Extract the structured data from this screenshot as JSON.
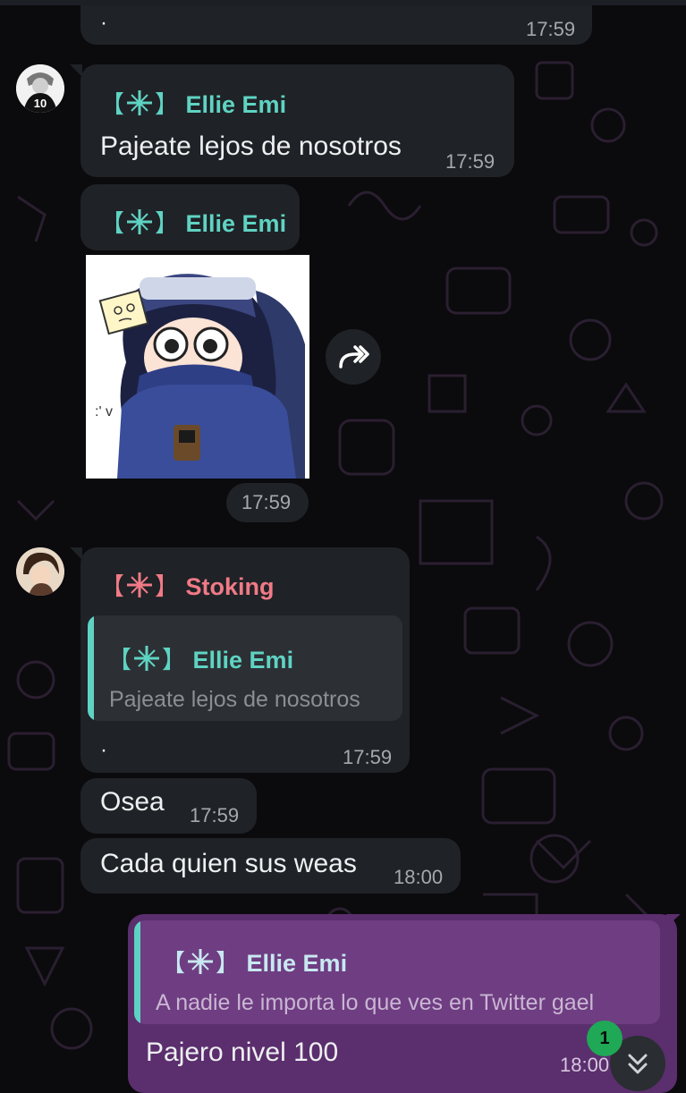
{
  "messages": [
    {
      "id": "m1",
      "text": "·",
      "time": "17:59"
    },
    {
      "id": "m2",
      "sender": "Ellie Emi",
      "bracket_left": "【",
      "bracket_right": "】",
      "text": "Pajeate lejos de nosotros",
      "time": "17:59"
    },
    {
      "id": "m3",
      "sender": "Ellie Emi",
      "bracket_left": "【",
      "bracket_right": "】",
      "type": "sticker",
      "time": "17:59"
    },
    {
      "id": "m4",
      "sender": "Stoking",
      "bracket_left": "【",
      "bracket_right": "】",
      "quote": {
        "sender": "Ellie Emi",
        "text": "Pajeate lejos de nosotros"
      },
      "text": "·",
      "time": "17:59"
    },
    {
      "id": "m5",
      "text": "Osea",
      "time": "17:59"
    },
    {
      "id": "m6",
      "text": "Cada quien sus weas",
      "time": "18:00"
    },
    {
      "id": "m7",
      "outgoing": true,
      "quote": {
        "sender": "Ellie Emi",
        "text": "A nadie le importa lo que ves en Twitter gael"
      },
      "text": "Pajero nivel 100",
      "time": "18:00"
    }
  ],
  "unread_badge": "1",
  "icons": {
    "forward": "forward-icon",
    "scroll_down": "double-chevron-down-icon",
    "sticker_tag": "sticky-note-icon"
  },
  "colors": {
    "background": "#0b0a0d",
    "bubble_incoming": "#1f2226",
    "bubble_outgoing": "#5b2e6e",
    "sender_ellie": "#5fd3c3",
    "sender_stoking": "#f07a86",
    "badge": "#1fa855"
  }
}
